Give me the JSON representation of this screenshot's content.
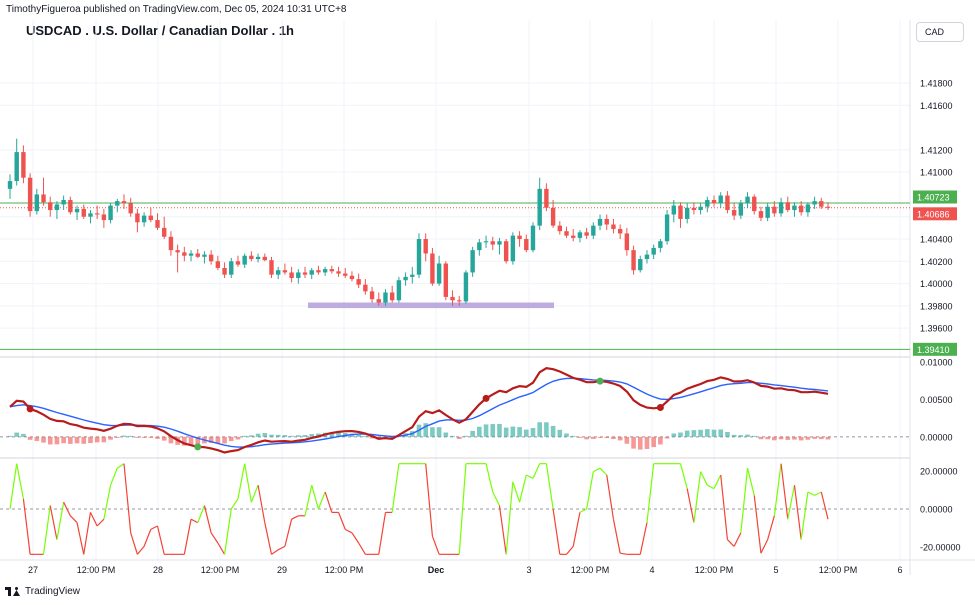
{
  "header": {
    "published_by": "TimothyFigueroa published on TradingView.com, Dec 05, 2024 10:31 UTC+8",
    "title": "USDCAD . U.S. Dollar / Canadian Dollar . 1h",
    "currency_button": "CAD",
    "brand": "TradingView"
  },
  "colors": {
    "up": "#26a69a",
    "down": "#ef5350",
    "resistance": "#4caf50",
    "support_zone": "#b39ddb",
    "signal_fast": "#4caf50",
    "signal_slow": "#2962ff",
    "signal_dark": "#b71c1c",
    "osc_up": "#76ff03",
    "osc_down": "#f44336"
  },
  "chart_data": [
    {
      "type": "candlestick",
      "title": "USDCAD . U.S. Dollar / Canadian Dollar . 1h",
      "y_ticks": [
        "1.41800",
        "1.41600",
        "1.41200",
        "1.41000",
        "1.40600",
        "1.40400",
        "1.40200",
        "1.40000",
        "1.39800",
        "1.39600"
      ],
      "ylim": [
        1.3935,
        1.4215
      ],
      "x_ticks": [
        "27",
        "12:00 PM",
        "28",
        "12:00 PM",
        "29",
        "12:00 PM",
        "Dec",
        "3",
        "12:00 PM",
        "4",
        "12:00 PM",
        "5",
        "12:00 PM",
        "6"
      ],
      "price_labels": {
        "upper_line": "1.40723",
        "last_price": "1.40686",
        "lower_line": "1.39410"
      },
      "horizontal_lines": [
        1.40723,
        1.3941
      ],
      "support_zone": [
        1.3978,
        1.3983
      ],
      "candles": [
        [
          1.4085,
          1.4098,
          1.4076,
          1.4092
        ],
        [
          1.4092,
          1.413,
          1.4088,
          1.4118
        ],
        [
          1.4118,
          1.4124,
          1.409,
          1.4095
        ],
        [
          1.4095,
          1.4099,
          1.406,
          1.4065
        ],
        [
          1.4065,
          1.4085,
          1.4062,
          1.408
        ],
        [
          1.408,
          1.4095,
          1.407,
          1.4073
        ],
        [
          1.4073,
          1.4078,
          1.406,
          1.4066
        ],
        [
          1.4066,
          1.4074,
          1.4058,
          1.4071
        ],
        [
          1.4071,
          1.4079,
          1.4066,
          1.4075
        ],
        [
          1.4075,
          1.4078,
          1.4062,
          1.4064
        ],
        [
          1.4064,
          1.407,
          1.4057,
          1.4067
        ],
        [
          1.4067,
          1.4071,
          1.4058,
          1.406
        ],
        [
          1.406,
          1.4066,
          1.4054,
          1.4063
        ],
        [
          1.4063,
          1.407,
          1.4058,
          1.4062
        ],
        [
          1.4062,
          1.4067,
          1.405,
          1.4057
        ],
        [
          1.4057,
          1.4072,
          1.4054,
          1.407
        ],
        [
          1.407,
          1.4076,
          1.4064,
          1.4074
        ],
        [
          1.4074,
          1.408,
          1.4067,
          1.4072
        ],
        [
          1.4072,
          1.4077,
          1.406,
          1.4063
        ],
        [
          1.4063,
          1.4067,
          1.4046,
          1.4055
        ],
        [
          1.4055,
          1.4064,
          1.4051,
          1.4061
        ],
        [
          1.4061,
          1.4068,
          1.4055,
          1.4057
        ],
        [
          1.4057,
          1.4063,
          1.4048,
          1.405
        ],
        [
          1.405,
          1.406,
          1.404,
          1.4042
        ],
        [
          1.4042,
          1.4047,
          1.4025,
          1.403
        ],
        [
          1.403,
          1.4035,
          1.401,
          1.4028
        ],
        [
          1.4028,
          1.4033,
          1.402,
          1.4025
        ],
        [
          1.4025,
          1.403,
          1.402,
          1.4027
        ],
        [
          1.4027,
          1.4031,
          1.4023,
          1.4024
        ],
        [
          1.4024,
          1.4029,
          1.4018,
          1.4026
        ],
        [
          1.4026,
          1.403,
          1.4017,
          1.402
        ],
        [
          1.402,
          1.4025,
          1.4012,
          1.4014
        ],
        [
          1.4014,
          1.4019,
          1.4005,
          1.4008
        ],
        [
          1.4008,
          1.4023,
          1.4005,
          1.402
        ],
        [
          1.402,
          1.4025,
          1.4015,
          1.4017
        ],
        [
          1.4017,
          1.4027,
          1.4014,
          1.4025
        ],
        [
          1.4025,
          1.4029,
          1.402,
          1.4022
        ],
        [
          1.4022,
          1.4027,
          1.4019,
          1.4024
        ],
        [
          1.4024,
          1.4027,
          1.402,
          1.4021
        ],
        [
          1.4021,
          1.4024,
          1.4005,
          1.4008
        ],
        [
          1.4008,
          1.4015,
          1.4004,
          1.4012
        ],
        [
          1.4012,
          1.4018,
          1.4008,
          1.401
        ],
        [
          1.401,
          1.4015,
          1.4001,
          1.4005
        ],
        [
          1.4005,
          1.4013,
          1.4,
          1.401
        ],
        [
          1.401,
          1.4015,
          1.4005,
          1.4008
        ],
        [
          1.4008,
          1.4014,
          1.4004,
          1.4012
        ],
        [
          1.4012,
          1.4016,
          1.4008,
          1.401
        ],
        [
          1.401,
          1.4015,
          1.4007,
          1.4013
        ],
        [
          1.4013,
          1.4016,
          1.4009,
          1.4011
        ],
        [
          1.4011,
          1.4015,
          1.4006,
          1.4009
        ],
        [
          1.4009,
          1.4014,
          1.4005,
          1.4007
        ],
        [
          1.4007,
          1.4011,
          1.4002,
          1.4004
        ],
        [
          1.4004,
          1.4009,
          1.3996,
          1.3999
        ],
        [
          1.3999,
          1.4004,
          1.399,
          1.3993
        ],
        [
          1.3993,
          1.3997,
          1.3983,
          1.3986
        ],
        [
          1.3986,
          1.3992,
          1.398,
          1.3983
        ],
        [
          1.3983,
          1.3995,
          1.398,
          1.3992
        ],
        [
          1.3992,
          1.3998,
          1.3983,
          1.3985
        ],
        [
          1.3985,
          1.4006,
          1.3983,
          1.4003
        ],
        [
          1.4003,
          1.401,
          1.3998,
          1.4006
        ],
        [
          1.4006,
          1.4015,
          1.4,
          1.4008
        ],
        [
          1.4008,
          1.4045,
          1.4005,
          1.404
        ],
        [
          1.404,
          1.4045,
          1.402,
          1.4027
        ],
        [
          1.4027,
          1.4032,
          1.3998,
          1.4
        ],
        [
          1.4,
          1.4025,
          1.3998,
          1.4018
        ],
        [
          1.4018,
          1.402,
          1.3985,
          1.3988
        ],
        [
          1.3988,
          1.3994,
          1.398,
          1.3985
        ],
        [
          1.3985,
          1.3989,
          1.398,
          1.3984
        ],
        [
          1.3984,
          1.4012,
          1.3982,
          1.401
        ],
        [
          1.401,
          1.4033,
          1.4006,
          1.403
        ],
        [
          1.403,
          1.404,
          1.4025,
          1.4037
        ],
        [
          1.4037,
          1.4043,
          1.4032,
          1.4038
        ],
        [
          1.4038,
          1.4042,
          1.403,
          1.4035
        ],
        [
          1.4035,
          1.4041,
          1.4026,
          1.4038
        ],
        [
          1.4038,
          1.404,
          1.4018,
          1.402
        ],
        [
          1.402,
          1.4046,
          1.4017,
          1.4043
        ],
        [
          1.4043,
          1.4047,
          1.4033,
          1.404
        ],
        [
          1.404,
          1.4044,
          1.4028,
          1.403
        ],
        [
          1.403,
          1.4055,
          1.4028,
          1.4052
        ],
        [
          1.4052,
          1.4095,
          1.4048,
          1.4085
        ],
        [
          1.4085,
          1.409,
          1.4065,
          1.4068
        ],
        [
          1.4068,
          1.4075,
          1.405,
          1.4052
        ],
        [
          1.4052,
          1.4056,
          1.4044,
          1.4047
        ],
        [
          1.4047,
          1.4051,
          1.4041,
          1.4043
        ],
        [
          1.4043,
          1.4049,
          1.4038,
          1.4041
        ],
        [
          1.4041,
          1.4048,
          1.4037,
          1.4046
        ],
        [
          1.4046,
          1.405,
          1.404,
          1.4043
        ],
        [
          1.4043,
          1.4055,
          1.404,
          1.4052
        ],
        [
          1.4052,
          1.4062,
          1.4048,
          1.4058
        ],
        [
          1.4058,
          1.4062,
          1.4048,
          1.4053
        ],
        [
          1.4053,
          1.4058,
          1.4045,
          1.4049
        ],
        [
          1.4049,
          1.4053,
          1.404,
          1.4045
        ],
        [
          1.4045,
          1.405,
          1.4025,
          1.403
        ],
        [
          1.403,
          1.4034,
          1.4008,
          1.4012
        ],
        [
          1.4012,
          1.4025,
          1.401,
          1.4022
        ],
        [
          1.4022,
          1.403,
          1.4018,
          1.4026
        ],
        [
          1.4026,
          1.4035,
          1.4022,
          1.4032
        ],
        [
          1.4032,
          1.404,
          1.4028,
          1.4038
        ],
        [
          1.4038,
          1.4066,
          1.4035,
          1.4062
        ],
        [
          1.4062,
          1.4075,
          1.4055,
          1.407
        ],
        [
          1.407,
          1.4073,
          1.405,
          1.4058
        ],
        [
          1.4058,
          1.4072,
          1.4054,
          1.4068
        ],
        [
          1.4068,
          1.4073,
          1.4062,
          1.4066
        ],
        [
          1.4066,
          1.4072,
          1.4062,
          1.4069
        ],
        [
          1.4069,
          1.4078,
          1.4064,
          1.4075
        ],
        [
          1.4075,
          1.4079,
          1.4069,
          1.4072
        ],
        [
          1.4072,
          1.4082,
          1.4068,
          1.4079
        ],
        [
          1.4079,
          1.4083,
          1.4063,
          1.4066
        ],
        [
          1.4066,
          1.4072,
          1.4057,
          1.4061
        ],
        [
          1.4061,
          1.4075,
          1.4058,
          1.4072
        ],
        [
          1.4072,
          1.4082,
          1.4068,
          1.4078
        ],
        [
          1.4078,
          1.408,
          1.4062,
          1.4065
        ],
        [
          1.4065,
          1.4069,
          1.4056,
          1.4059
        ],
        [
          1.4059,
          1.4072,
          1.4056,
          1.4069
        ],
        [
          1.4069,
          1.4074,
          1.406,
          1.4063
        ],
        [
          1.4063,
          1.4077,
          1.406,
          1.4073
        ],
        [
          1.4073,
          1.4078,
          1.4064,
          1.4066
        ],
        [
          1.4066,
          1.4073,
          1.406,
          1.407
        ],
        [
          1.407,
          1.4074,
          1.4061,
          1.4064
        ],
        [
          1.4064,
          1.4073,
          1.406,
          1.4071
        ],
        [
          1.4071,
          1.4078,
          1.4067,
          1.4074
        ],
        [
          1.4074,
          1.4077,
          1.4067,
          1.4069
        ],
        [
          1.4069,
          1.4073,
          1.4066,
          1.4068
        ]
      ]
    },
    {
      "type": "line",
      "name": "signal oscillator",
      "y_ticks": [
        "0.01000",
        "0.00500",
        "0.00000"
      ],
      "ylim": [
        -0.0027,
        0.0107
      ],
      "markers": [
        {
          "bar": 3,
          "color": "#b71c1c"
        },
        {
          "bar": 28,
          "color": "#4caf50"
        },
        {
          "bar": 70,
          "color": "#b71c1c"
        },
        {
          "bar": 87,
          "color": "#4caf50"
        },
        {
          "bar": 96,
          "color": "#b71c1c"
        }
      ]
    },
    {
      "type": "line",
      "name": "momentum oscillator",
      "y_ticks": [
        "20.00000",
        "0.00000",
        "-20.00000"
      ],
      "ylim": [
        -27,
        27
      ]
    }
  ]
}
